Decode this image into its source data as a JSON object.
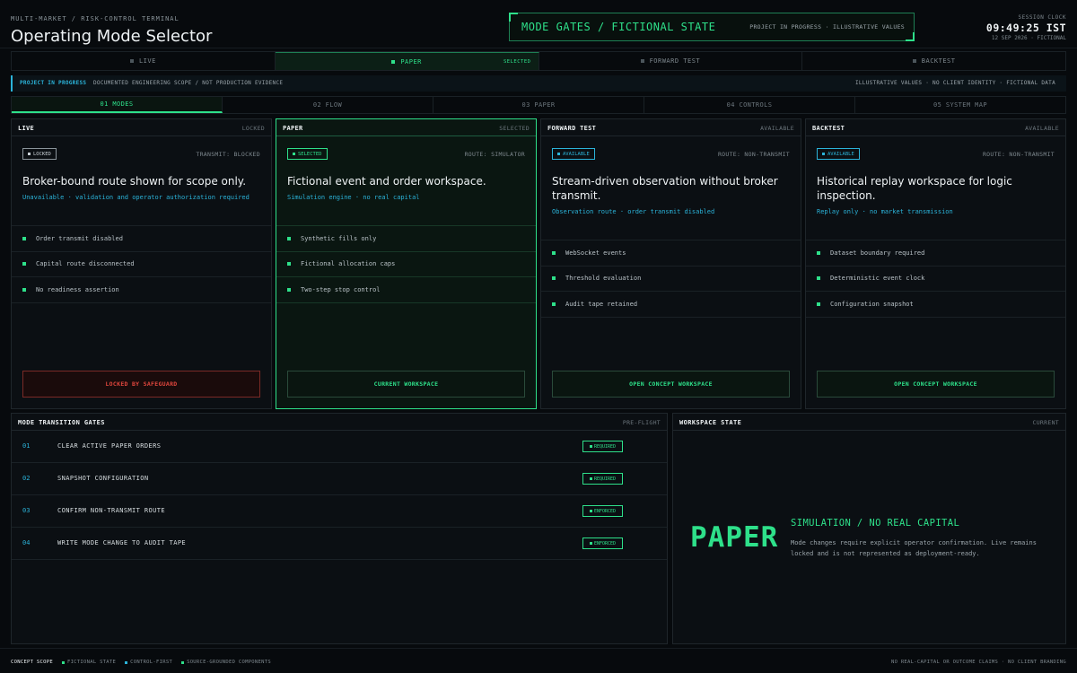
{
  "header": {
    "subtitle": "MULTI-MARKET / RISK-CONTROL TERMINAL",
    "title": "Operating Mode Selector",
    "gate_title": "MODE GATES / FICTIONAL STATE",
    "gate_note": "PROJECT IN PROGRESS · ILLUSTRATIVE VALUES",
    "clock_label": "SESSION CLOCK",
    "clock": "09:49:25 IST",
    "clock_date": "12 SEP 2026 · FICTIONAL"
  },
  "mode_tabs": [
    {
      "label": "LIVE",
      "tag": ""
    },
    {
      "label": "PAPER",
      "tag": "SELECTED"
    },
    {
      "label": "FORWARD TEST",
      "tag": ""
    },
    {
      "label": "BACKTEST",
      "tag": ""
    }
  ],
  "banner": {
    "status": "PROJECT IN PROGRESS",
    "scope": "DOCUMENTED ENGINEERING SCOPE / NOT PRODUCTION EVIDENCE",
    "right": "ILLUSTRATIVE VALUES · NO CLIENT IDENTITY · FICTIONAL DATA"
  },
  "section_tabs": [
    "01 MODES",
    "02 FLOW",
    "03 PAPER",
    "04 CONTROLS",
    "05 SYSTEM MAP"
  ],
  "cards": [
    {
      "name": "LIVE",
      "status": "LOCKED",
      "badge": "LOCKED",
      "route": "TRANSMIT: BLOCKED",
      "headline": "Broker-bound route shown for scope only.",
      "desc": "Unavailable · validation and operator authorization required",
      "features": [
        "Order transmit disabled",
        "Capital route disconnected",
        "No readiness assertion"
      ],
      "button": "LOCKED BY SAFEGUARD"
    },
    {
      "name": "PAPER",
      "status": "SELECTED",
      "badge": "SELECTED",
      "route": "ROUTE: SIMULATOR",
      "headline": "Fictional event and order workspace.",
      "desc": "Simulation engine · no real capital",
      "features": [
        "Synthetic fills only",
        "Fictional allocation caps",
        "Two-step stop control"
      ],
      "button": "CURRENT WORKSPACE"
    },
    {
      "name": "FORWARD TEST",
      "status": "AVAILABLE",
      "badge": "AVAILABLE",
      "route": "ROUTE: NON-TRANSMIT",
      "headline": "Stream-driven observation without broker transmit.",
      "desc": "Observation route · order transmit disabled",
      "features": [
        "WebSocket events",
        "Threshold evaluation",
        "Audit tape retained"
      ],
      "button": "OPEN CONCEPT WORKSPACE"
    },
    {
      "name": "BACKTEST",
      "status": "AVAILABLE",
      "badge": "AVAILABLE",
      "route": "ROUTE: NON-TRANSMIT",
      "headline": "Historical replay workspace for logic inspection.",
      "desc": "Replay only · no market transmission",
      "features": [
        "Dataset boundary required",
        "Deterministic event clock",
        "Configuration snapshot"
      ],
      "button": "OPEN CONCEPT WORKSPACE"
    }
  ],
  "gates_panel": {
    "title": "MODE TRANSITION GATES",
    "tag": "PRE-FLIGHT",
    "rows": [
      {
        "num": "01",
        "text": "CLEAR ACTIVE PAPER ORDERS",
        "badge": "REQUIRED"
      },
      {
        "num": "02",
        "text": "SNAPSHOT CONFIGURATION",
        "badge": "REQUIRED"
      },
      {
        "num": "03",
        "text": "CONFIRM NON-TRANSMIT ROUTE",
        "badge": "ENFORCED"
      },
      {
        "num": "04",
        "text": "WRITE MODE CHANGE TO AUDIT TAPE",
        "badge": "ENFORCED"
      }
    ]
  },
  "workspace_panel": {
    "title": "WORKSPACE STATE",
    "tag": "CURRENT",
    "mode": "PAPER",
    "line": "SIMULATION / NO REAL CAPITAL",
    "note": "Mode changes require explicit operator confirmation. Live remains locked and is not represented as deployment-ready."
  },
  "footer": {
    "label": "CONCEPT SCOPE",
    "items": [
      "FICTIONAL STATE",
      "CONTROL-FIRST",
      "SOURCE-GROUNDED COMPONENTS"
    ],
    "right": "NO REAL-CAPITAL OR OUTCOME CLAIMS · NO CLIENT BRANDING"
  },
  "colors": {
    "accent": "#2ee08a",
    "info": "#2bb3d9",
    "danger": "#e0463d",
    "background": "#070a0d"
  }
}
